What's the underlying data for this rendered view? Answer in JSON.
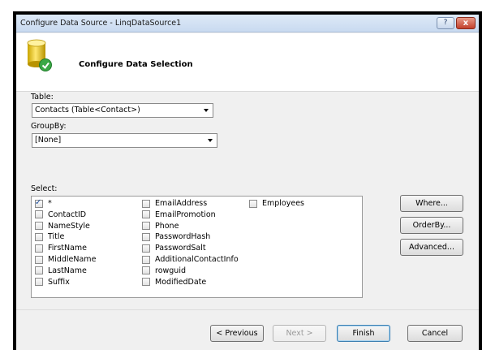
{
  "window": {
    "title": "Configure Data Source - LinqDataSource1",
    "help_label": "?",
    "close_label": "x"
  },
  "header": {
    "title": "Configure Data Selection",
    "icon": "database-icon"
  },
  "table": {
    "label": "Table:",
    "value": "Contacts (Table<Contact>)"
  },
  "groupby": {
    "label": "GroupBy:",
    "value": "[None]"
  },
  "select": {
    "label": "Select:",
    "columns": [
      [
        {
          "label": "*",
          "checked": true
        },
        {
          "label": "ContactID",
          "checked": false
        },
        {
          "label": "NameStyle",
          "checked": false
        },
        {
          "label": "Title",
          "checked": false
        },
        {
          "label": "FirstName",
          "checked": false
        },
        {
          "label": "MiddleName",
          "checked": false
        },
        {
          "label": "LastName",
          "checked": false
        },
        {
          "label": "Suffix",
          "checked": false
        }
      ],
      [
        {
          "label": "EmailAddress",
          "checked": false
        },
        {
          "label": "EmailPromotion",
          "checked": false
        },
        {
          "label": "Phone",
          "checked": false
        },
        {
          "label": "PasswordHash",
          "checked": false
        },
        {
          "label": "PasswordSalt",
          "checked": false
        },
        {
          "label": "AdditionalContactInfo",
          "checked": false
        },
        {
          "label": "rowguid",
          "checked": false
        },
        {
          "label": "ModifiedDate",
          "checked": false
        }
      ],
      [
        {
          "label": "Employees",
          "checked": false
        }
      ]
    ]
  },
  "side_buttons": {
    "where": "Where...",
    "orderby": "OrderBy...",
    "advanced": "Advanced..."
  },
  "footer_buttons": {
    "previous": "< Previous",
    "next": "Next >",
    "finish": "Finish",
    "cancel": "Cancel"
  },
  "colors": {
    "accent": "#3c7fb1",
    "close": "#c2402b"
  }
}
